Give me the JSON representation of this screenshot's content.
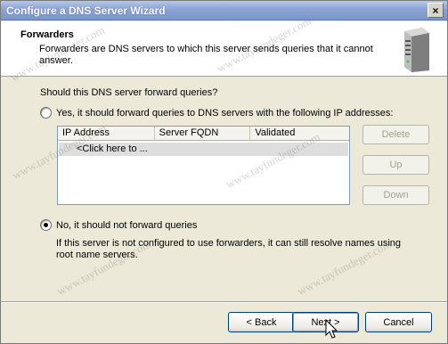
{
  "window": {
    "title": "Configure a DNS Server Wizard",
    "close_glyph": "×"
  },
  "header": {
    "title": "Forwarders",
    "description": "Forwarders are DNS servers to which this server sends queries that it cannot answer."
  },
  "form": {
    "question": "Should this DNS server forward queries?",
    "yes_option": {
      "label": "Yes, it should forward queries to DNS servers with the following IP addresses:",
      "selected": false
    },
    "no_option": {
      "label": "No, it should not forward queries",
      "selected": true,
      "description": "If this server is not configured to use forwarders, it can still resolve names using root name servers."
    }
  },
  "forwarders_list": {
    "columns": [
      "IP Address",
      "Server FQDN",
      "Validated"
    ],
    "placeholder_row": "<Click here to ..."
  },
  "side_buttons": {
    "delete": "Delete",
    "up": "Up",
    "down": "Down"
  },
  "footer": {
    "back": "< Back",
    "next": "Next >",
    "cancel": "Cancel"
  },
  "watermark": "www.tayfundeger.com",
  "colors": {
    "titlebar": "#8aa3d4",
    "dialog_bg": "#ece9d8",
    "header_bg": "#ffffff",
    "button_border": "#003c74"
  }
}
